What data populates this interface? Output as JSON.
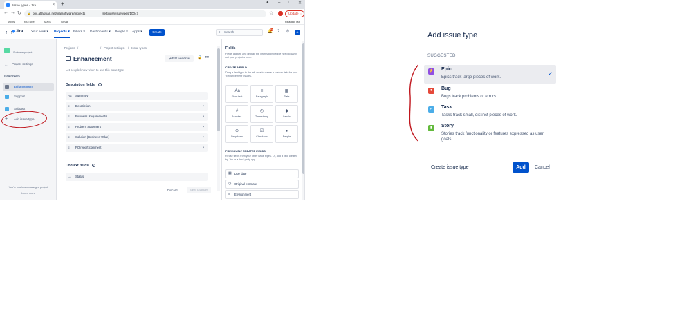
{
  "browser": {
    "tab_title": "Issue types - Jira",
    "tab_close": "×",
    "new_tab": "+",
    "window_controls": [
      "–",
      "□",
      "✕"
    ],
    "url_left": "opc.atlassian.net/jira/software/projects",
    "url_right": "/settings/issuetypes/10047",
    "update_label": "Update",
    "bookmarks": [
      {
        "label": "Apps",
        "color": "#4285f4"
      },
      {
        "label": "YouTube",
        "color": "#ff0000"
      },
      {
        "label": "Maps",
        "color": "#34a853"
      },
      {
        "label": "Gmail",
        "color": "#ea4335"
      }
    ],
    "reading_list": "Reading list"
  },
  "jira_nav": {
    "logo": "Jira",
    "items": [
      "Your work ▾",
      "Projects ▾",
      "Filters ▾",
      "Dashboards ▾",
      "People ▾",
      "Apps ▾"
    ],
    "create": "Create",
    "search_placeholder": "Search",
    "notif_count": "9+",
    "user_initial": "A"
  },
  "sidebar": {
    "project_label": "Software project",
    "project_settings": "Project settings",
    "issue_types_heading": "Issue types",
    "items": [
      {
        "label": "Enhancement",
        "color": "#6b778c"
      },
      {
        "label": "Support",
        "color": "#4bade8"
      },
      {
        "label": "Subtask",
        "color": "#4bade8"
      }
    ],
    "add_issue_type": "Add issue type",
    "footer_line1": "You're in a team-managed project",
    "footer_link": "Learn more"
  },
  "main": {
    "breadcrumbs": [
      "Projects",
      "/",
      "/",
      "Project settings",
      "/",
      "Issue types"
    ],
    "title": "Enhancement",
    "edit_workflow": "Edit workflow",
    "description_hint": "Let people know when to use this issue type",
    "description_fields_heading": "Description fields",
    "description_fields": [
      "Summary",
      "Description",
      "Business Requirements",
      "Problem Statement",
      "Solution (Business Value)",
      "PO report comment"
    ],
    "context_fields_heading": "Context fields",
    "context_fields": [
      "Status"
    ],
    "discard": "Discard",
    "save_changes": "Save changes"
  },
  "fields_panel": {
    "heading": "Fields",
    "intro": "Fields capture and display the information people need to carry out your project's work.",
    "create_heading": "CREATE A FIELD",
    "create_text": "Drag a field type to the left area to create a custom field for your \"Enhancement\" issues.",
    "tiles": [
      "Short text",
      "Paragraph",
      "Date",
      "Number",
      "Time stamp",
      "Labels",
      "Dropdown",
      "Checkbox",
      "People"
    ],
    "previous_heading": "PREVIOUSLY CREATED FIELDS",
    "previous_text": "Reuse fields from your other issue types. Or, add a field created by Jira or a third-party app.",
    "previous_fields": [
      "Due date",
      "Original estimate",
      "Environment"
    ]
  },
  "modal": {
    "title": "Add issue type",
    "suggested": "SUGGESTED",
    "types": [
      {
        "name": "Epic",
        "desc": "Epics track large pieces of work.",
        "color": "#904ee2",
        "icon": "lightning-icon",
        "selected": true
      },
      {
        "name": "Bug",
        "desc": "Bugs track problems or errors.",
        "color": "#e5493a",
        "icon": "bug-icon",
        "selected": false
      },
      {
        "name": "Task",
        "desc": "Tasks track small, distinct pieces of work.",
        "color": "#4bade8",
        "icon": "check-icon",
        "selected": false
      },
      {
        "name": "Story",
        "desc": "Stories track functionality or features expressed as user goals.",
        "color": "#63ba3c",
        "icon": "bookmark-icon",
        "selected": false
      }
    ],
    "create_issue_type": "Create issue type",
    "add": "Add",
    "cancel": "Cancel"
  },
  "annotation_color": "#c0161d"
}
